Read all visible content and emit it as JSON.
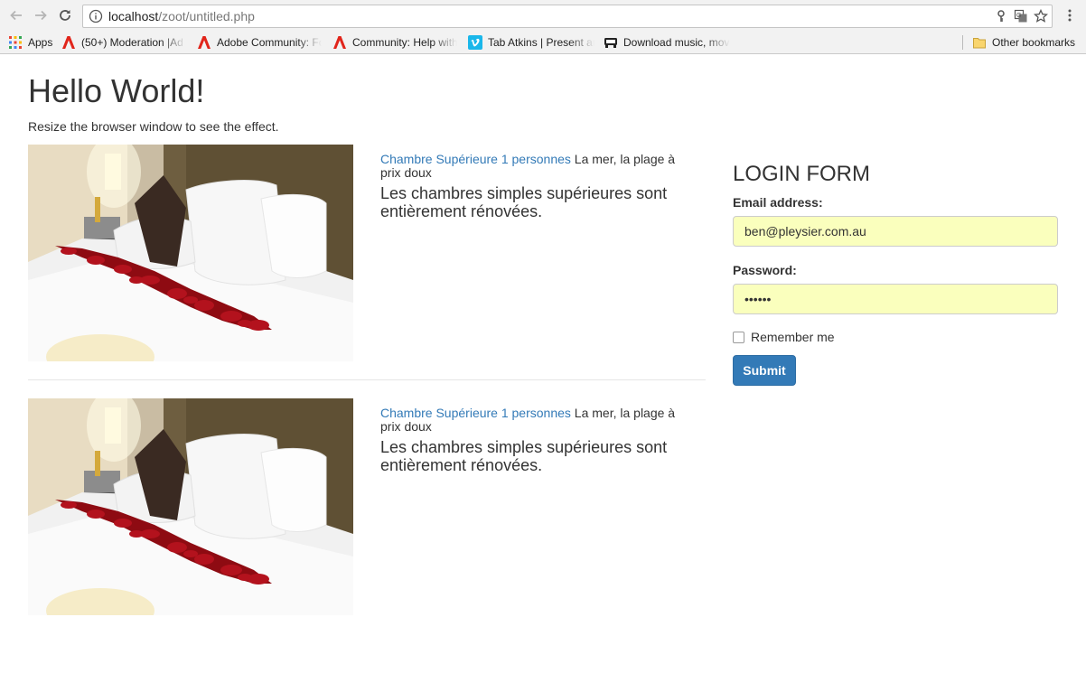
{
  "browser": {
    "url_host": "localhost",
    "url_path": "/zoot/untitled.php",
    "bookmarks": [
      {
        "label": "Apps",
        "icon": "apps-grid-icon"
      },
      {
        "label": "(50+) Moderation |Ad",
        "icon": "adobe-icon"
      },
      {
        "label": "Adobe Community: Fo",
        "icon": "adobe-icon"
      },
      {
        "label": "Community: Help with",
        "icon": "adobe-icon"
      },
      {
        "label": "Tab Atkins | Present an",
        "icon": "vimeo-icon"
      },
      {
        "label": "Download music, mov",
        "icon": "download-site-icon"
      }
    ],
    "other_bookmarks": "Other bookmarks"
  },
  "page": {
    "title": "Hello World!",
    "lead": "Resize the browser window to see the effect."
  },
  "rooms": [
    {
      "link": "Chambre Supérieure 1 personnes",
      "tagline": " La mer, la plage à prix doux",
      "description": "Les chambres simples supérieures sont entièrement rénovées.",
      "image": "hotel-bed-rose-petals"
    },
    {
      "link": "Chambre Supérieure 1 personnes",
      "tagline": " La mer, la plage à prix doux",
      "description": "Les chambres simples supérieures sont entièrement rénovées.",
      "image": "hotel-bed-rose-petals"
    }
  ],
  "login": {
    "title": "LOGIN FORM",
    "email_label": "Email address:",
    "email_value": "ben@pleysier.com.au",
    "password_label": "Password:",
    "password_value": "••••••",
    "remember_label": "Remember me",
    "remember_checked": false,
    "submit_label": "Submit"
  },
  "colors": {
    "link": "#337ab7",
    "button": "#337ab7",
    "autofill": "#faffbd"
  }
}
